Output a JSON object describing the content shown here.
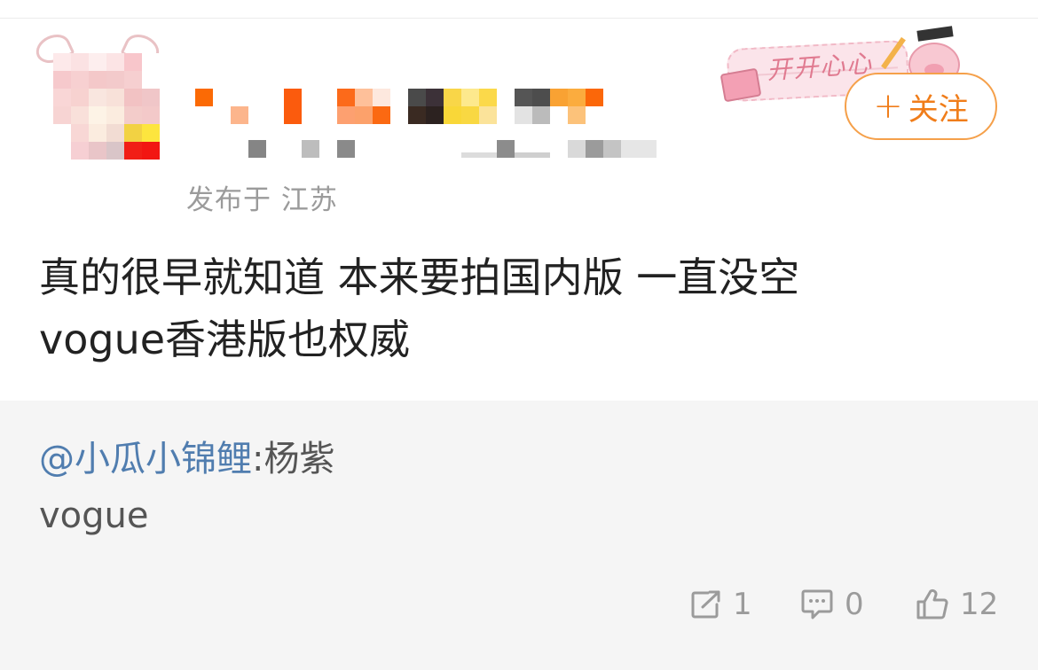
{
  "post": {
    "location": "发布于 江苏",
    "follow_label": "关注",
    "follow_plus": "+",
    "badge_text": "开开心心",
    "content_lines": [
      "真的很早就知道 本来要拍国内版 一直没空",
      "vogue香港版也权威"
    ]
  },
  "quote": {
    "mention": "@小瓜小锦鲤",
    "separator": ":",
    "text_line1": "杨紫",
    "text_line2": "vogue"
  },
  "actions": {
    "forward_count": "1",
    "comment_count": "0",
    "like_count": "12"
  },
  "colors": {
    "accent_orange": "#f07d1a",
    "mention_blue": "#507daf",
    "muted_gray": "#9b9b9b",
    "quote_bg": "#f5f5f5"
  },
  "icons": [
    "forward-icon",
    "comment-icon",
    "like-icon",
    "plus-icon"
  ]
}
